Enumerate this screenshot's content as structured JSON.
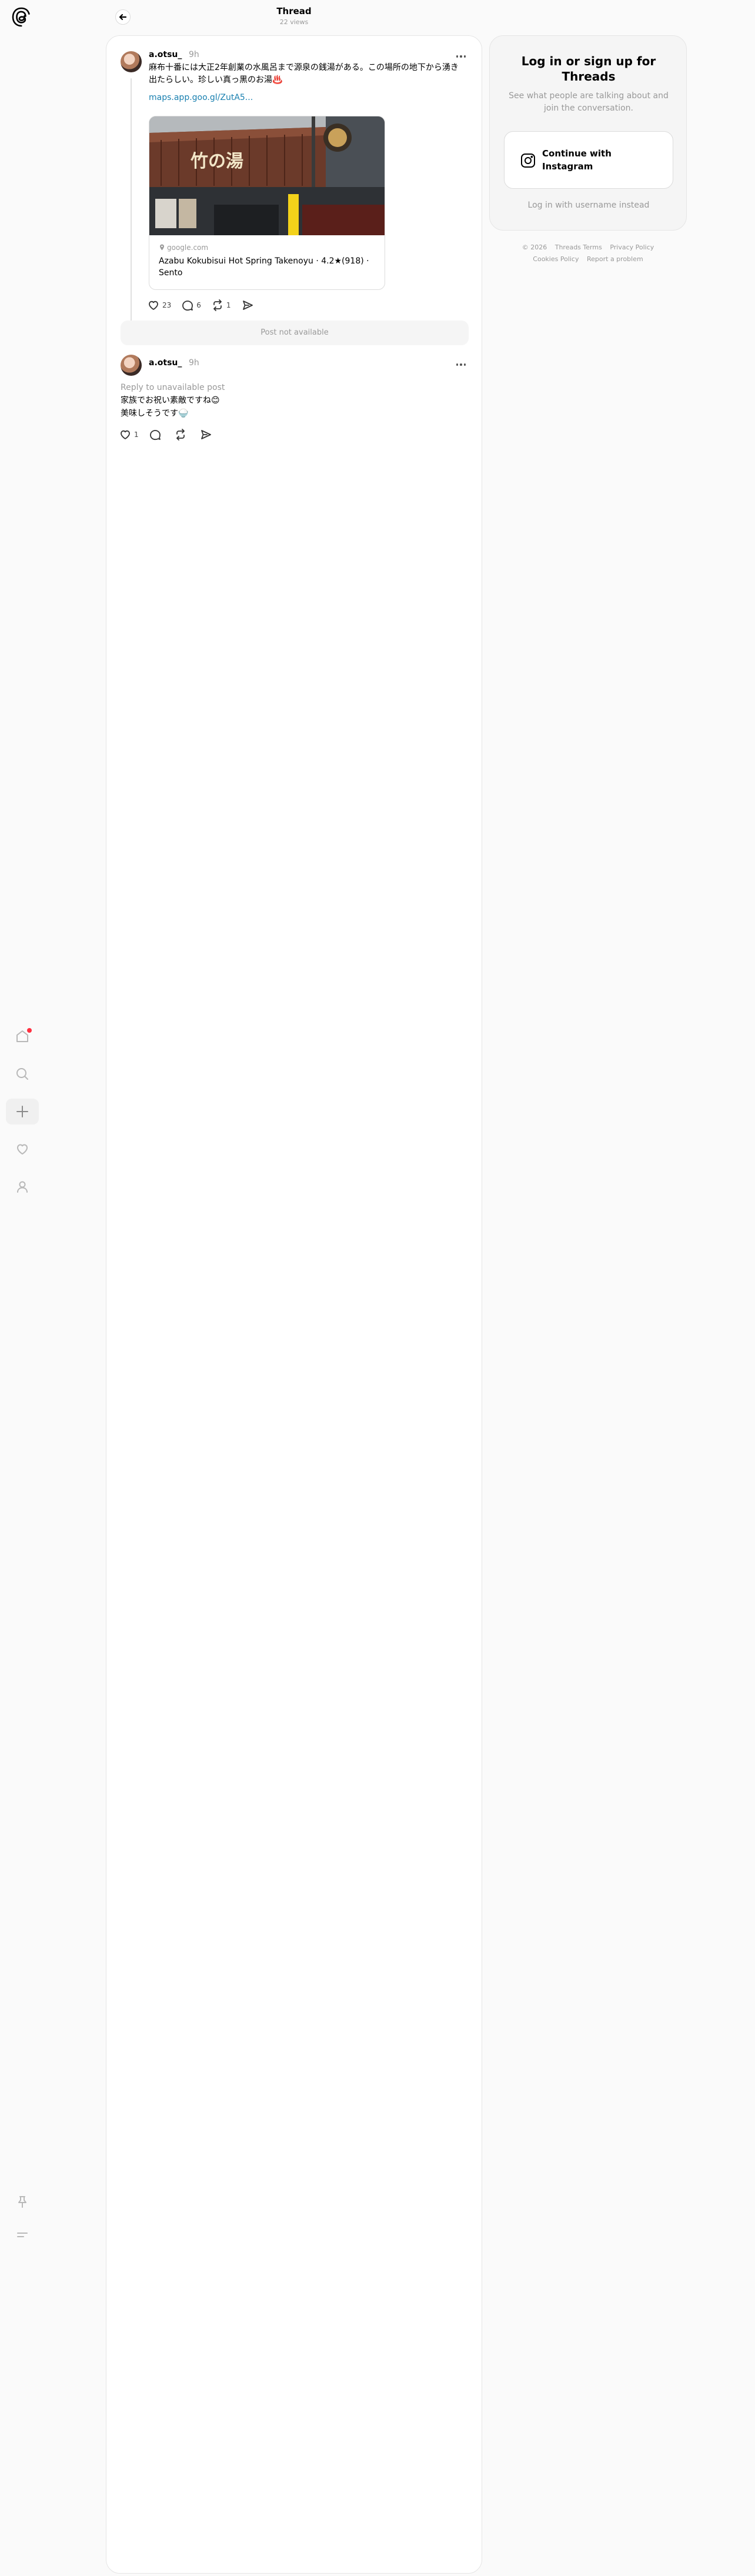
{
  "header": {
    "title": "Thread",
    "views": "22 views"
  },
  "rail": {
    "items": [
      {
        "name": "home"
      },
      {
        "name": "search"
      },
      {
        "name": "create"
      },
      {
        "name": "activity"
      },
      {
        "name": "profile"
      },
      {
        "name": "pin"
      },
      {
        "name": "menu"
      }
    ]
  },
  "post": {
    "username": "a.otsu_",
    "time": "9h",
    "text": "麻布十番には大正2年創業の水風呂まで源泉の銭湯がある。この場所の地下から湧き出たらしい。珍しい真っ黒のお湯♨️",
    "link": "maps.app.goo.gl/ZutA5...",
    "card": {
      "domain": "google.com",
      "title": "Azabu Kokubisui Hot Spring Takenoyu · 4.2★(918) · Sento",
      "sign_text": "竹の湯"
    },
    "stats": {
      "likes": "23",
      "replies": "6",
      "reposts": "1"
    }
  },
  "unavailable": "Post not available",
  "reply": {
    "username": "a.otsu_",
    "time": "9h",
    "reply_to": "Reply to unavailable post",
    "text_line1": "家族でお祝い素敵ですね😊",
    "text_line2": "美味しそうです🍚",
    "stats": {
      "likes": "1"
    }
  },
  "login": {
    "title": "Log in or sign up for Threads",
    "subtitle": "See what people are talking about and join the conversation.",
    "button": "Continue with Instagram",
    "alt": "Log in with username instead"
  },
  "footer": {
    "copyright": "© 2026",
    "terms": "Threads Terms",
    "privacy": "Privacy Policy",
    "cookies": "Cookies Policy",
    "report": "Report a problem"
  },
  "colors": {
    "accent_link": "#1a80b0",
    "notif_dot": "#ff3040",
    "muted": "#999999"
  }
}
